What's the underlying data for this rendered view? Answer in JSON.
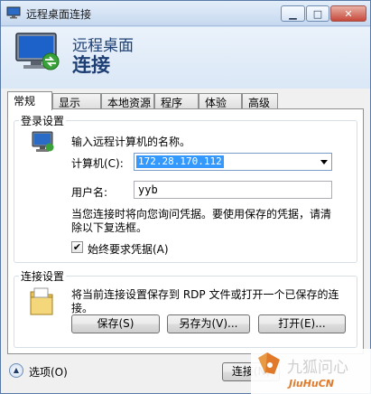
{
  "window": {
    "title": "远程桌面连接"
  },
  "header": {
    "line1": "远程桌面",
    "line2": "连接"
  },
  "tabs": [
    {
      "label": "常规",
      "active": true
    },
    {
      "label": "显示",
      "active": false
    },
    {
      "label": "本地资源",
      "active": false
    },
    {
      "label": "程序",
      "active": false
    },
    {
      "label": "体验",
      "active": false
    },
    {
      "label": "高级",
      "active": false
    }
  ],
  "login": {
    "group_title": "登录设置",
    "prompt": "输入远程计算机的名称。",
    "computer_label": "计算机(C):",
    "computer_value": "172.28.170.112",
    "username_label": "用户名:",
    "username_value": "yyb",
    "info": "当您连接时将向您询问凭据。要使用保存的凭据，请清除以下复选框。",
    "info_line1": "当您连接时将向您询问凭据。要使用保存的凭据，请清",
    "info_line2": "除以下复选框。",
    "always_ask_label": "始终要求凭据(A)",
    "always_ask_checked": true
  },
  "connection": {
    "group_title": "连接设置",
    "info_line1": "将当前连接设置保存到 RDP 文件或打开一个已保存的连",
    "info_line2": "接。",
    "save_label": "保存(S)",
    "save_as_label": "另存为(V)...",
    "open_label": "打开(E)..."
  },
  "footer": {
    "options_label": "选项(O)",
    "connect_label": "连接(N)"
  },
  "watermark": {
    "text": "九狐问心",
    "sub": "JiuHuCN"
  },
  "colors": {
    "header_text": "#1e3f74",
    "selection": "#3399ff",
    "watermark": "#e07a2a"
  }
}
